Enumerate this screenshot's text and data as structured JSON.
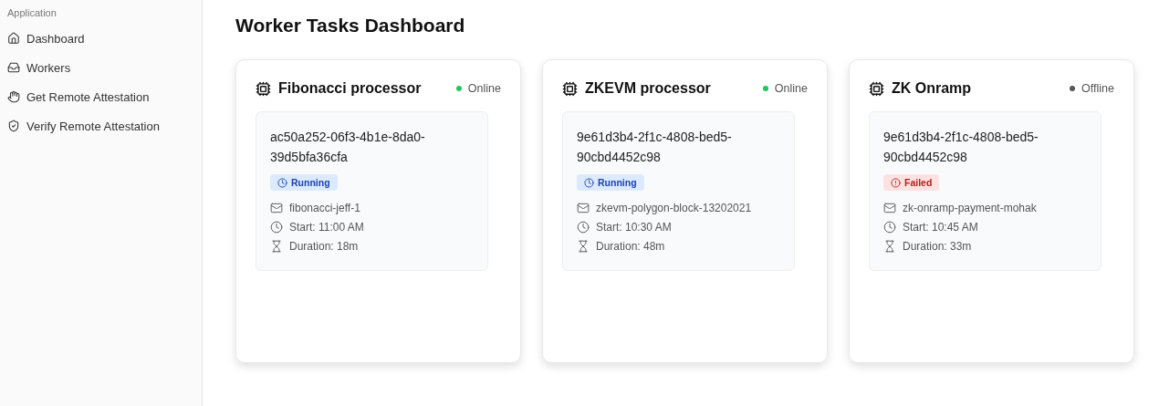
{
  "sidebar": {
    "group_label": "Application",
    "items": [
      {
        "label": "Dashboard"
      },
      {
        "label": "Workers"
      },
      {
        "label": "Get Remote Attestation"
      },
      {
        "label": "Verify Remote Attestation"
      }
    ]
  },
  "title": "Worker Tasks Dashboard",
  "workers": [
    {
      "name": "Fibonacci processor",
      "status": {
        "kind": "online",
        "label": "Online"
      },
      "tasks": [
        {
          "id": "ac50a252-06f3-4b1e-8da0-39d5bfa36cfa",
          "state": {
            "kind": "running",
            "label": "Running"
          },
          "job": "fibonacci-jeff-1",
          "start": "Start: 11:00 AM",
          "duration": "Duration: 18m"
        }
      ]
    },
    {
      "name": "ZKEVM processor",
      "status": {
        "kind": "online",
        "label": "Online"
      },
      "tasks": [
        {
          "id": "9e61d3b4-2f1c-4808-bed5-90cbd4452c98",
          "state": {
            "kind": "running",
            "label": "Running"
          },
          "job": "zkevm-polygon-block-13202021",
          "start": "Start: 10:30 AM",
          "duration": "Duration: 48m"
        }
      ]
    },
    {
      "name": "ZK Onramp",
      "status": {
        "kind": "offline",
        "label": "Offline"
      },
      "tasks": [
        {
          "id": "9e61d3b4-2f1c-4808-bed5-90cbd4452c98",
          "state": {
            "kind": "failed",
            "label": "Failed"
          },
          "job": "zk-onramp-payment-mohak",
          "start": "Start: 10:45 AM",
          "duration": "Duration: 33m"
        }
      ]
    }
  ]
}
